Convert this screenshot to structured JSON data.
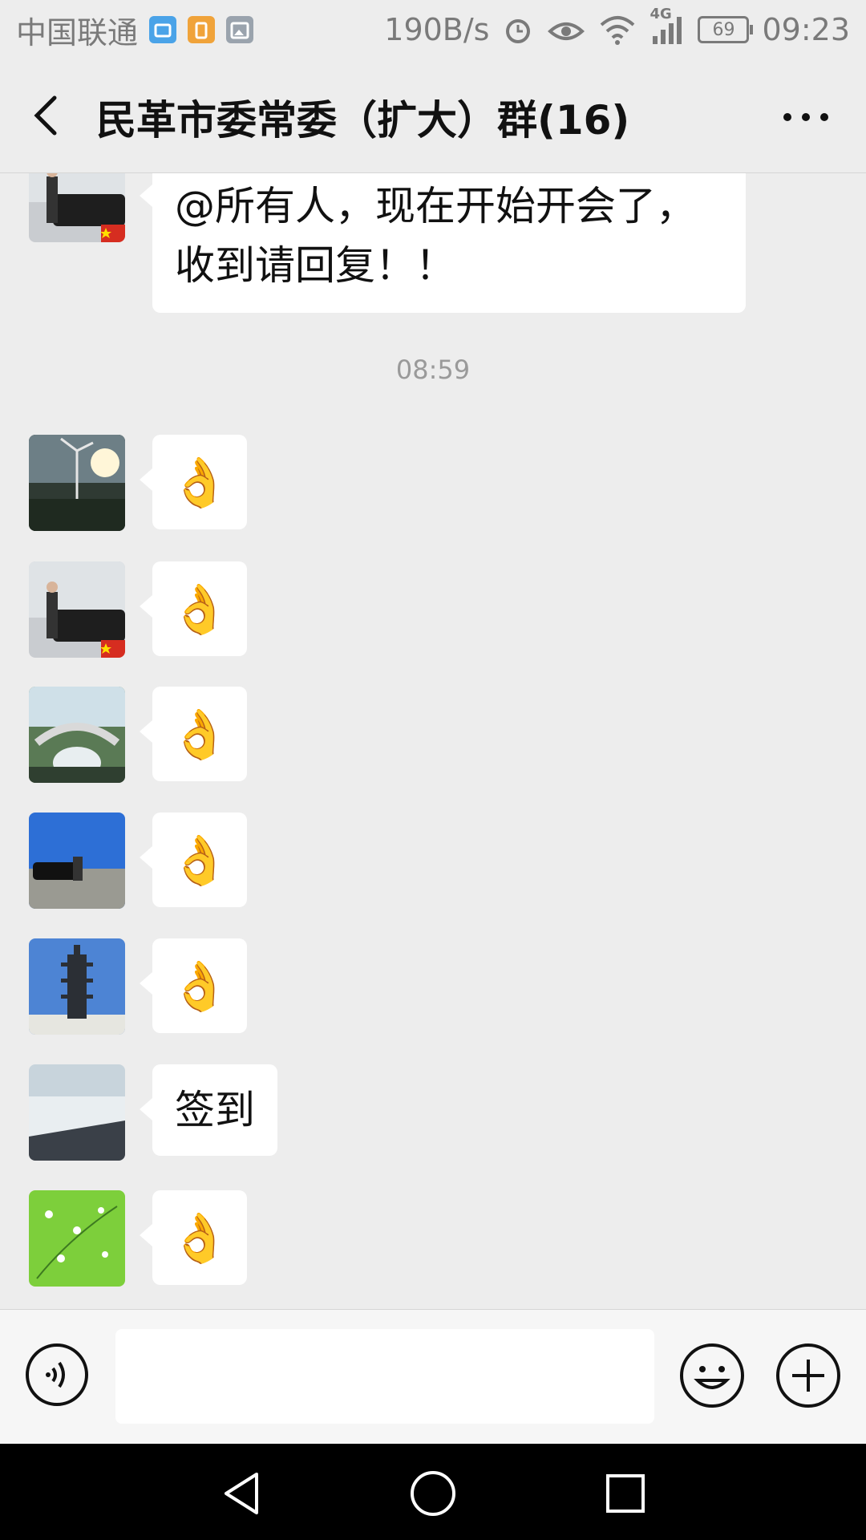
{
  "status_bar": {
    "carrier": "中国联通",
    "network_speed": "190B/s",
    "network_type": "4G",
    "battery": "69",
    "time": "09:23"
  },
  "header": {
    "title": "民革市委常委（扩大）群(16)",
    "back_icon": "chevron-left-icon",
    "more_icon": "more-dots-icon"
  },
  "messages": [
    {
      "type": "text",
      "text": "@所有人，现在开始开会了，收到请回复！！"
    },
    {
      "type": "timestamp",
      "text": "08:59"
    },
    {
      "type": "emoji",
      "emoji": "👌"
    },
    {
      "type": "emoji",
      "emoji": "👌"
    },
    {
      "type": "emoji",
      "emoji": "👌"
    },
    {
      "type": "emoji",
      "emoji": "👌"
    },
    {
      "type": "emoji",
      "emoji": "👌"
    },
    {
      "type": "text",
      "text": "签到"
    },
    {
      "type": "emoji",
      "emoji": "👌"
    }
  ],
  "input_bar": {
    "message_value": "",
    "voice_icon": "voice-icon",
    "emoji_icon": "emoji-icon",
    "plus_icon": "plus-icon"
  },
  "colors": {
    "background": "#ededed",
    "bubble": "#ffffff",
    "nav_bar": "#000000"
  }
}
